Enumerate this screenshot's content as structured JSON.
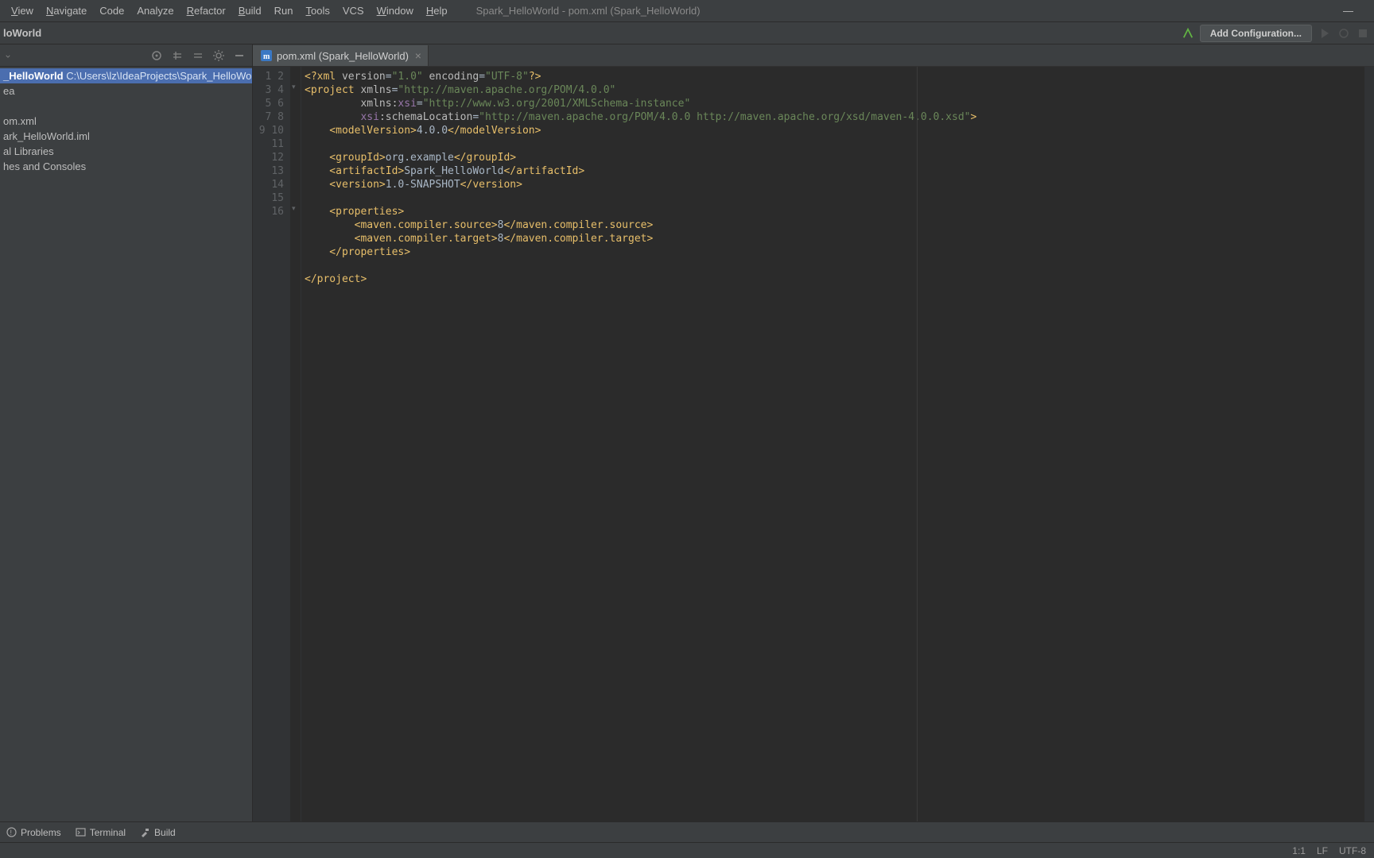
{
  "menu": {
    "items": [
      "View",
      "Navigate",
      "Code",
      "Analyze",
      "Refactor",
      "Build",
      "Run",
      "Tools",
      "VCS",
      "Window",
      "Help"
    ],
    "underlines": [
      0,
      0,
      -1,
      -1,
      0,
      0,
      -1,
      0,
      -1,
      0,
      0
    ],
    "title": "Spark_HelloWorld - pom.xml (Spark_HelloWorld)"
  },
  "breadcrumb": {
    "project": "loWorld"
  },
  "toolbar": {
    "add_configuration": "Add Configuration..."
  },
  "projectTree": {
    "selected": {
      "name": "_HelloWorld",
      "path": "C:\\Users\\lz\\IdeaProjects\\Spark_HelloWorld"
    },
    "items": [
      "ea",
      "",
      "om.xml",
      "ark_HelloWorld.iml",
      "al Libraries",
      "hes and Consoles"
    ]
  },
  "tab": {
    "label": "pom.xml (Spark_HelloWorld)"
  },
  "code": {
    "l1_a": "<?xml ",
    "l1_b": "version",
    "l1_c": "=",
    "l1_d": "\"1.0\"",
    "l1_e": " encoding",
    "l1_f": "=",
    "l1_g": "\"UTF-8\"",
    "l1_h": "?>",
    "l2_a": "<project ",
    "l2_b": "xmlns",
    "l2_c": "=",
    "l2_d": "\"http://maven.apache.org/POM/4.0.0\"",
    "l3_a": "         ",
    "l3_b": "xmlns:",
    "l3_c": "xsi",
    "l3_d": "=",
    "l3_e": "\"http://www.w3.org/2001/XMLSchema-instance\"",
    "l4_a": "         ",
    "l4_b": "xsi",
    "l4_c": ":schemaLocation",
    "l4_d": "=",
    "l4_e": "\"http://maven.apache.org/POM/4.0.0 http://maven.apache.org/xsd/maven-4.0.0.xsd\"",
    "l4_f": ">",
    "l5_a": "    <modelVersion>",
    "l5_b": "4.0.0",
    "l5_c": "</modelVersion>",
    "l7_a": "    <groupId>",
    "l7_b": "org.example",
    "l7_c": "</groupId>",
    "l8_a": "    <artifactId>",
    "l8_b": "Spark_HelloWorld",
    "l8_c": "</artifactId>",
    "l9_a": "    <version>",
    "l9_b": "1.0-SNAPSHOT",
    "l9_c": "</version>",
    "l11_a": "    <properties>",
    "l12_a": "        <maven.compiler.source>",
    "l12_b": "8",
    "l12_c": "</maven.compiler.source>",
    "l13_a": "        <maven.compiler.target>",
    "l13_b": "8",
    "l13_c": "</maven.compiler.target>",
    "l14_a": "    </properties>",
    "l16_a": "</project>"
  },
  "bottomTools": {
    "problems": "Problems",
    "terminal": "Terminal",
    "build": "Build"
  },
  "status": {
    "pos": "1:1",
    "sep": "LF",
    "enc": "UTF-8"
  }
}
